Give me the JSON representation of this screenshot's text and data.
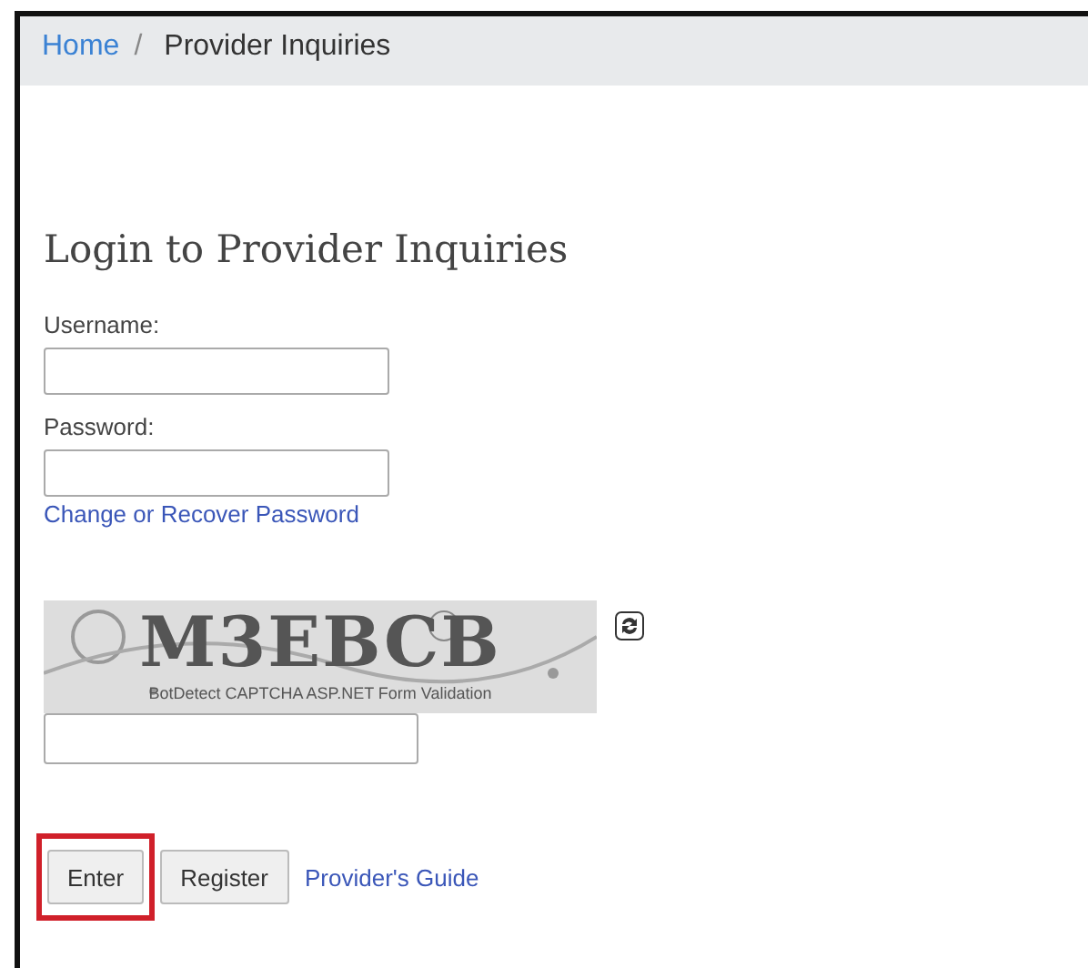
{
  "breadcrumb": [
    {
      "label": "Home",
      "kind": "link"
    },
    {
      "label": "Provider Inquiries",
      "kind": "current"
    }
  ],
  "breadcrumb_separator": "/",
  "heading": "Login to Provider Inquiries",
  "fields": [
    {
      "label": "Username:"
    },
    {
      "label": "Password:"
    }
  ],
  "recover_link": "Change or Recover Password",
  "captcha": {
    "code": "M3EBCB",
    "caption": "BotDetect CAPTCHA ASP.NET Form Validation"
  },
  "buttons": [
    {
      "label": "Enter",
      "highlighted": true
    },
    {
      "label": "Register",
      "highlighted": false
    }
  ],
  "guide_link": "Provider's Guide"
}
